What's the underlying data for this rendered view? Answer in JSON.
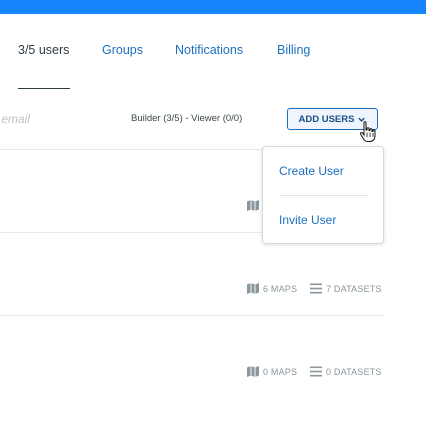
{
  "tabs": [
    {
      "label": "3/5 users"
    },
    {
      "label": "Groups"
    },
    {
      "label": "Notifications"
    },
    {
      "label": "Billing"
    }
  ],
  "search": {
    "placeholder": "r email"
  },
  "seat_info": "Builder (3/5) - Viewer (0/0)",
  "add_users": {
    "label": "ADD USERS"
  },
  "menu": {
    "items": [
      {
        "label": "Create User"
      },
      {
        "label": "Invite User"
      }
    ]
  },
  "rows": [
    {
      "maps": "",
      "datasets": ""
    },
    {
      "maps": "6 MAPS",
      "datasets": "7 DATASETS"
    },
    {
      "maps": "0 MAPS",
      "datasets": "0 DATASETS"
    }
  ],
  "colors": {
    "topbar": "#1785fb",
    "link": "#1c6fc0",
    "muted": "#8a969c"
  },
  "icons": {
    "map": "map-icon",
    "datasets": "list-icon",
    "chevron": "chevron-down-icon",
    "cursor": "hand-pointer-icon"
  }
}
